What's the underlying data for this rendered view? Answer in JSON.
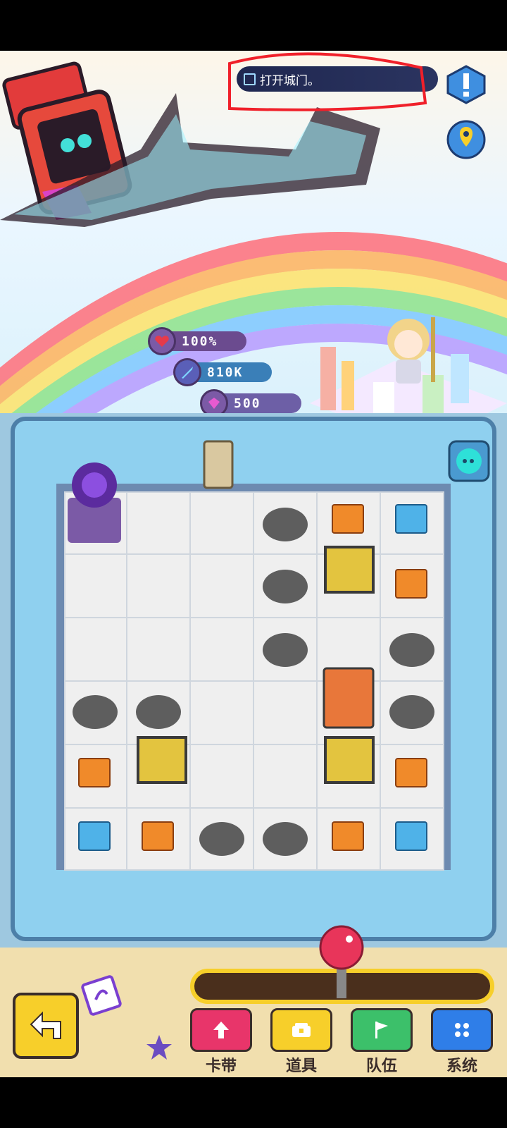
{
  "quest": {
    "text": "打开城门。"
  },
  "stats": {
    "health": "100%",
    "attack": "810K",
    "gems": "500"
  },
  "menu": {
    "cassette_label": "卡带",
    "items_label": "道具",
    "team_label": "队伍",
    "system_label": "系统"
  },
  "icons": {
    "quest_checkbox": "checkbox-icon",
    "alert": "exclamation-icon",
    "map": "map-pin-icon",
    "chat": "chat-bubble-icon",
    "back": "back-arrow-icon",
    "cassette": "up-arrow-icon",
    "items": "chest-icon",
    "team": "flag-icon",
    "system": "dots-grid-icon",
    "favorite": "star-icon"
  },
  "colors": {
    "health": "#e63a4a",
    "attack": "#2e8ad8",
    "gems": "#7a3fd0",
    "accent": "#f7cf2a"
  }
}
